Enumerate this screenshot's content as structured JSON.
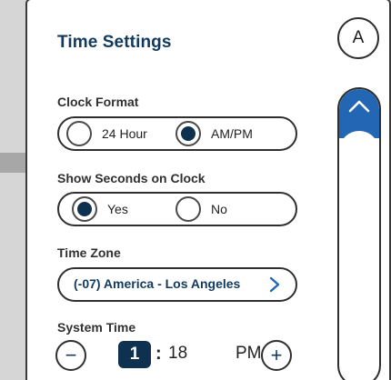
{
  "panel": {
    "title": "Time Settings",
    "avatar_letter": "A"
  },
  "clock_format": {
    "label": "Clock Format",
    "options": [
      {
        "label": "24 Hour",
        "selected": false
      },
      {
        "label": "AM/PM",
        "selected": true
      }
    ]
  },
  "show_seconds": {
    "label": "Show Seconds on Clock",
    "options": [
      {
        "label": "Yes",
        "selected": true
      },
      {
        "label": "No",
        "selected": false
      }
    ]
  },
  "time_zone": {
    "label": "Time Zone",
    "value": "(-07) America - Los Angeles",
    "icon": "chevron-right-icon"
  },
  "system_time": {
    "label": "System Time",
    "hour": "1",
    "separator": ":",
    "minute": "18",
    "period": "PM",
    "decrement_symbol": "−",
    "increment_symbol": "+"
  },
  "colors": {
    "accent_dark": "#0e3150",
    "title_blue": "#123a5e",
    "scroll_blue": "#2266b4",
    "border": "#2f2f2f"
  }
}
